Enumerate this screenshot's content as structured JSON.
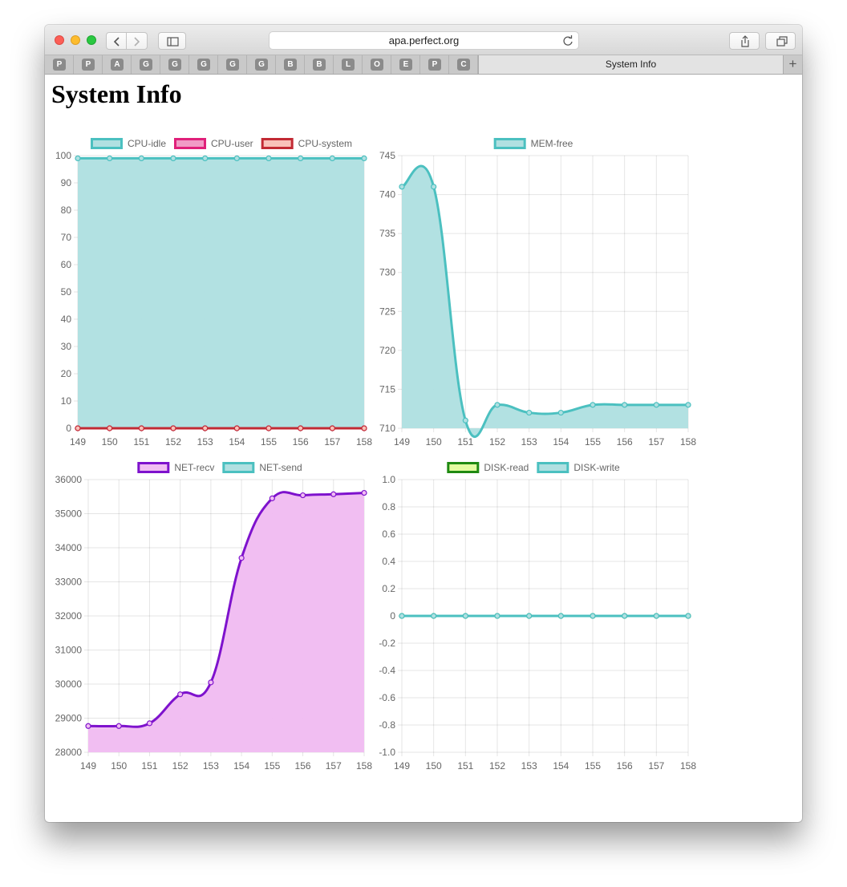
{
  "browser": {
    "url": "apa.perfect.org",
    "pinned_tabs": [
      "P",
      "P",
      "A",
      "G",
      "G",
      "G",
      "G",
      "G",
      "B",
      "B",
      "L",
      "O",
      "E",
      "P",
      "C"
    ],
    "active_tab": "System Info",
    "new_tab_label": "+"
  },
  "page": {
    "title": "System Info"
  },
  "chart_data": [
    {
      "id": "cpu",
      "type": "area",
      "x": [
        149,
        150,
        151,
        152,
        153,
        154,
        155,
        156,
        157,
        158
      ],
      "ylim": [
        0,
        100
      ],
      "yticks": [
        0,
        10,
        20,
        30,
        40,
        50,
        60,
        70,
        80,
        90,
        100
      ],
      "ytick_labels": [
        "0",
        "10",
        "20",
        "30",
        "40",
        "50",
        "60",
        "70",
        "80",
        "90",
        "100"
      ],
      "grid": true,
      "legend": "top",
      "series": [
        {
          "name": "CPU-idle",
          "values": [
            99,
            99,
            99,
            99,
            99,
            99,
            99,
            99,
            99,
            99
          ],
          "color": "#4bc0c0",
          "fill": "#b0e0e1",
          "filled": true
        },
        {
          "name": "CPU-user",
          "values": [
            0,
            0,
            0,
            0,
            0,
            0,
            0,
            0,
            0,
            0
          ],
          "color": "#e0207a",
          "fill": "#f19bc6",
          "filled": false
        },
        {
          "name": "CPU-system",
          "values": [
            0,
            0,
            0,
            0,
            0,
            0,
            0,
            0,
            0,
            0
          ],
          "color": "#c22a34",
          "fill": "#f9c1b9",
          "filled": false
        }
      ]
    },
    {
      "id": "mem",
      "type": "area",
      "x": [
        149,
        150,
        151,
        152,
        153,
        154,
        155,
        156,
        157,
        158
      ],
      "ylim": [
        710,
        745
      ],
      "yticks": [
        710,
        715,
        720,
        725,
        730,
        735,
        740,
        745
      ],
      "ytick_labels": [
        "710",
        "715",
        "720",
        "725",
        "730",
        "735",
        "740",
        "745"
      ],
      "grid": true,
      "legend": "top",
      "series": [
        {
          "name": "MEM-free",
          "values": [
            741,
            741,
            711,
            713,
            712,
            712,
            713,
            713,
            713,
            713
          ],
          "color": "#4bc0c0",
          "fill": "#b0e0e1",
          "filled": true
        }
      ]
    },
    {
      "id": "net",
      "type": "area",
      "x": [
        149,
        150,
        151,
        152,
        153,
        154,
        155,
        156,
        157,
        158
      ],
      "ylim": [
        28000,
        36000
      ],
      "yticks": [
        28000,
        29000,
        30000,
        31000,
        32000,
        33000,
        34000,
        35000,
        36000
      ],
      "ytick_labels": [
        "28000",
        "29000",
        "30000",
        "31000",
        "32000",
        "33000",
        "34000",
        "35000",
        "36000"
      ],
      "grid": true,
      "legend": "top",
      "series": [
        {
          "name": "NET-recv",
          "values": [
            28770,
            28770,
            28850,
            29700,
            30050,
            33700,
            35450,
            35540,
            35570,
            35610
          ],
          "color": "#7e12cd",
          "fill": "#f1bdf2",
          "filled": true
        },
        {
          "name": "NET-send",
          "values": [
            null,
            null,
            null,
            null,
            null,
            null,
            null,
            null,
            null,
            null
          ],
          "color": "#4bc0c0",
          "fill": "#b0e0e1",
          "filled": true
        }
      ]
    },
    {
      "id": "disk",
      "type": "line",
      "x": [
        149,
        150,
        151,
        152,
        153,
        154,
        155,
        156,
        157,
        158
      ],
      "ylim": [
        -1.0,
        1.0
      ],
      "yticks": [
        -1.0,
        -0.8,
        -0.6,
        -0.4,
        -0.2,
        0,
        0.2,
        0.4,
        0.6,
        0.8,
        1.0
      ],
      "ytick_labels": [
        "-1.0",
        "-0.8",
        "-0.6",
        "-0.4",
        "-0.2",
        "0",
        "0.2",
        "0.4",
        "0.6",
        "0.8",
        "1.0"
      ],
      "grid": true,
      "legend": "top",
      "series": [
        {
          "name": "DISK-read",
          "values": [
            0,
            0,
            0,
            0,
            0,
            0,
            0,
            0,
            0,
            0
          ],
          "color": "#1f8a11",
          "fill": "#e3fca0",
          "filled": false
        },
        {
          "name": "DISK-write",
          "values": [
            0,
            0,
            0,
            0,
            0,
            0,
            0,
            0,
            0,
            0
          ],
          "color": "#4bc0c0",
          "fill": "#b0e0e1",
          "filled": false
        }
      ]
    }
  ]
}
